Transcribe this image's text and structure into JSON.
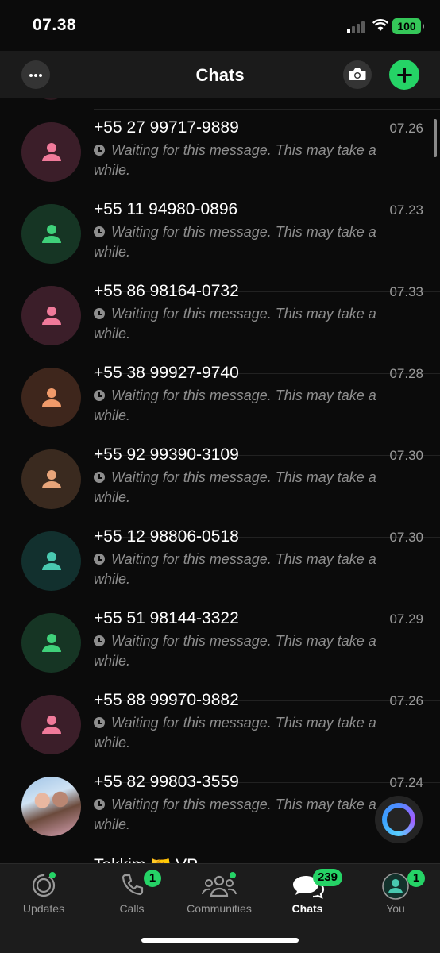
{
  "status": {
    "time": "07.38",
    "battery": "100"
  },
  "header": {
    "title": "Chats"
  },
  "chats": [
    {
      "name": "+55 27 99717-9889",
      "time": "07.26",
      "msg": "Waiting for this message. This may take a while.",
      "bg": "#3b1e29",
      "fg": "#f07a9a"
    },
    {
      "name": "+55 11 94980-0896",
      "time": "07.23",
      "msg": "Waiting for this message. This may take a while.",
      "bg": "#163524",
      "fg": "#3fd17a"
    },
    {
      "name": "+55 86 98164-0732",
      "time": "07.33",
      "msg": "Waiting for this message. This may take a while.",
      "bg": "#3b1e29",
      "fg": "#f07a9a"
    },
    {
      "name": "+55 38 99927-9740",
      "time": "07.28",
      "msg": "Waiting for this message. This may take a while.",
      "bg": "#3e261c",
      "fg": "#f09a6a"
    },
    {
      "name": "+55 92 99390-3109",
      "time": "07.30",
      "msg": "Waiting for this message. This may take a while.",
      "bg": "#3a2a1f",
      "fg": "#e8a57a"
    },
    {
      "name": "+55 12 98806-0518",
      "time": "07.30",
      "msg": "Waiting for this message. This may take a while.",
      "bg": "#12302e",
      "fg": "#49c9b0"
    },
    {
      "name": "+55 51 98144-3322",
      "time": "07.29",
      "msg": "Waiting for this message. This may take a while.",
      "bg": "#163524",
      "fg": "#3fd17a"
    },
    {
      "name": "+55 88 99970-9882",
      "time": "07.26",
      "msg": "Waiting for this message. This may take a while.",
      "bg": "#3b1e29",
      "fg": "#f07a9a"
    },
    {
      "name": "+55 82 99803-3559",
      "time": "07.24",
      "msg": "Waiting for this message. This may take a while.",
      "photo": true
    }
  ],
  "partial_chat": {
    "name": "Takkim 🤝 VP"
  },
  "tabs": [
    {
      "label": "Updates",
      "icon": "updates-icon"
    },
    {
      "label": "Calls",
      "icon": "phone-icon",
      "badge": "1"
    },
    {
      "label": "Communities",
      "icon": "communities-icon"
    },
    {
      "label": "Chats",
      "icon": "chats-icon",
      "badge": "239"
    },
    {
      "label": "You",
      "icon": "profile-icon",
      "badge": "1"
    }
  ],
  "colors": {
    "accent": "#25d366",
    "background": "#0b0b0b",
    "header": "#1b1b1b"
  }
}
